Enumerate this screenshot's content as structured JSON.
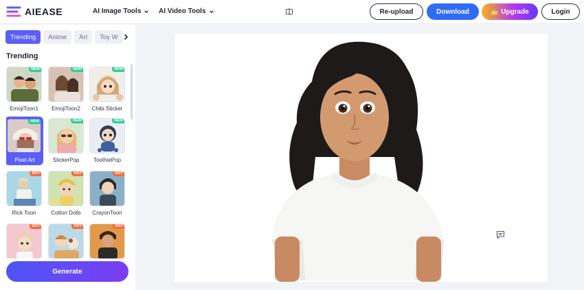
{
  "header": {
    "brand": "AIEASE",
    "nav": [
      {
        "label": "AI Image Tools"
      },
      {
        "label": "AI Video Tools"
      }
    ],
    "buttons": {
      "reupload": "Re-upload",
      "download": "Download",
      "upgrade": "Upgrade",
      "login": "Login"
    }
  },
  "sidebar": {
    "tabs": [
      "Trending",
      "Anime",
      "Art",
      "Toy W"
    ],
    "active_tab": "Trending",
    "section_title": "Trending",
    "styles": [
      {
        "label": "EmojiToon1",
        "badge": "NEW"
      },
      {
        "label": "EmojiToon2",
        "badge": "NEW"
      },
      {
        "label": "Chibi Sticker",
        "badge": "NEW"
      },
      {
        "label": "Pixel Art",
        "badge": "NEW",
        "selected": true
      },
      {
        "label": "StickerPop",
        "badge": "NEW"
      },
      {
        "label": "ToothiePop",
        "badge": "NEW"
      },
      {
        "label": "Rick Toon",
        "badge": "HOT"
      },
      {
        "label": "Cotton Dolls",
        "badge": "HOT"
      },
      {
        "label": "CrayonToon",
        "badge": "HOT"
      },
      {
        "label": "",
        "badge": "HOT"
      },
      {
        "label": "",
        "badge": "HOT"
      },
      {
        "label": "",
        "badge": "HOT"
      }
    ],
    "generate_label": "Generate"
  },
  "colors": {
    "accent": "#5b5ff7",
    "download": "#2f6bf5",
    "new_badge": "#2ecf95",
    "hot_badge": "#f26d3d"
  },
  "icons": [
    "logo-icon",
    "chevron-down-icon",
    "compare-icon",
    "crown-icon",
    "chevron-right-icon",
    "comment-icon"
  ]
}
